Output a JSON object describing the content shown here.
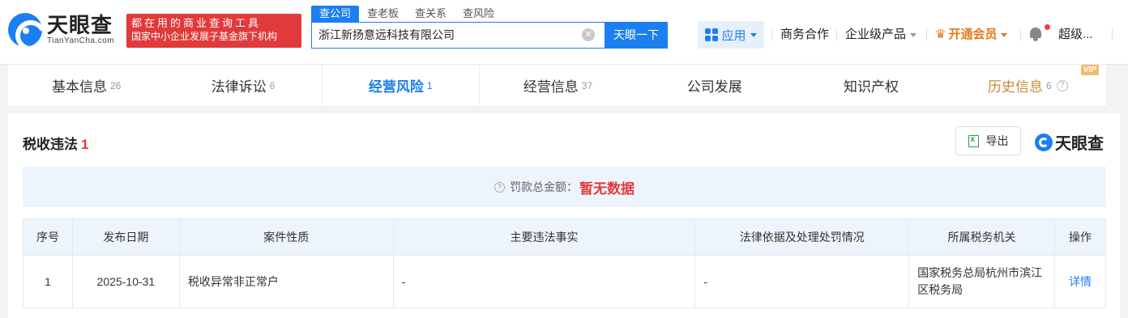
{
  "brand": {
    "name_cn": "天眼查",
    "name_en": "TianYanCha.com",
    "slogan_line1": "都在用的商业查询工具",
    "slogan_line2": "国家中小企业发展子基金旗下机构"
  },
  "search": {
    "tabs": [
      "查公司",
      "查老板",
      "查关系",
      "查风险"
    ],
    "query": "浙江新扬意远科技有限公司",
    "button": "天眼一下",
    "clear_icon": "close-circle-icon"
  },
  "topnav": {
    "apps": "应用",
    "business": "商务合作",
    "enterprise": "企业级产品",
    "vip": "开通会员",
    "user": "超级..."
  },
  "tabs": [
    {
      "label": "基本信息",
      "count": "26"
    },
    {
      "label": "法律诉讼",
      "count": "6"
    },
    {
      "label": "经营风险",
      "count": "1"
    },
    {
      "label": "经营信息",
      "count": "37"
    },
    {
      "label": "公司发展",
      "count": ""
    },
    {
      "label": "知识产权",
      "count": ""
    },
    {
      "label": "历史信息",
      "count": "6",
      "badge": "VIP"
    }
  ],
  "section": {
    "title": "税收违法",
    "count": "1",
    "export": "导出",
    "watermark": "天眼查",
    "fine_label": "罚款总金额：",
    "fine_value": "暂无数据"
  },
  "table": {
    "headers": [
      "序号",
      "发布日期",
      "案件性质",
      "主要违法事实",
      "法律依据及处理处罚情况",
      "所属税务机关",
      "操作"
    ],
    "rows": [
      {
        "no": "1",
        "date": "2025-10-31",
        "nature": "税收异常非正常户",
        "facts": "-",
        "basis": "-",
        "authority": "国家税务总局杭州市滨江区税务局",
        "action": "详情"
      }
    ]
  },
  "colors": {
    "accent": "#1b7ff0",
    "danger": "#e03a3a",
    "vip": "#e3791a"
  }
}
